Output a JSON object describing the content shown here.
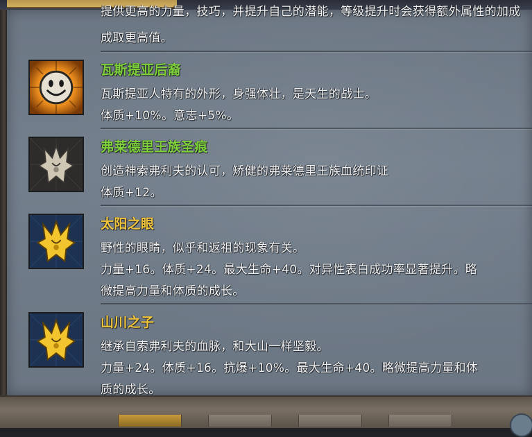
{
  "top_partial_line": "提供更高的力量，技巧，并提升自己的潜能，等级提升时会获得额外属性的加成",
  "top_line": "成取更高值。",
  "traits": [
    {
      "name": "瓦斯提亚后裔",
      "name_color": "green",
      "icon": "smiley-face-icon",
      "lines": [
        "瓦斯提亚人特有的外形，身强体壮，是天生的战士。",
        "体质+10%。意志+5%。"
      ]
    },
    {
      "name": "弗莱德里王族圣痕",
      "name_color": "green",
      "icon": "silver-crest-icon",
      "lines": [
        "创造神索弗利夫的认可，矫健的弗莱德里王族血统印证",
        "体质+12。"
      ]
    },
    {
      "name": "太阳之眼",
      "name_color": "gold",
      "icon": "golden-crest-icon",
      "lines": [
        "野性的眼睛，似乎和返祖的现象有关。",
        "力量+16。体质+24。最大生命+40。对异性表白成功率显著提升。略",
        "微提高力量和体质的成长。"
      ]
    },
    {
      "name": "山川之子",
      "name_color": "gold",
      "icon": "golden-crest-icon",
      "lines": [
        "继承自索弗利夫的血脉，和大山一样坚毅。",
        "力量+24。体质+16。抗爆+10%。最大生命+40。略微提高力量和体",
        "质的成长。"
      ]
    }
  ],
  "colors": {
    "green_title": "#7fd13a",
    "gold_title": "#f2c63c",
    "body_text": "#f2f2f2",
    "panel": "#737f8c"
  }
}
